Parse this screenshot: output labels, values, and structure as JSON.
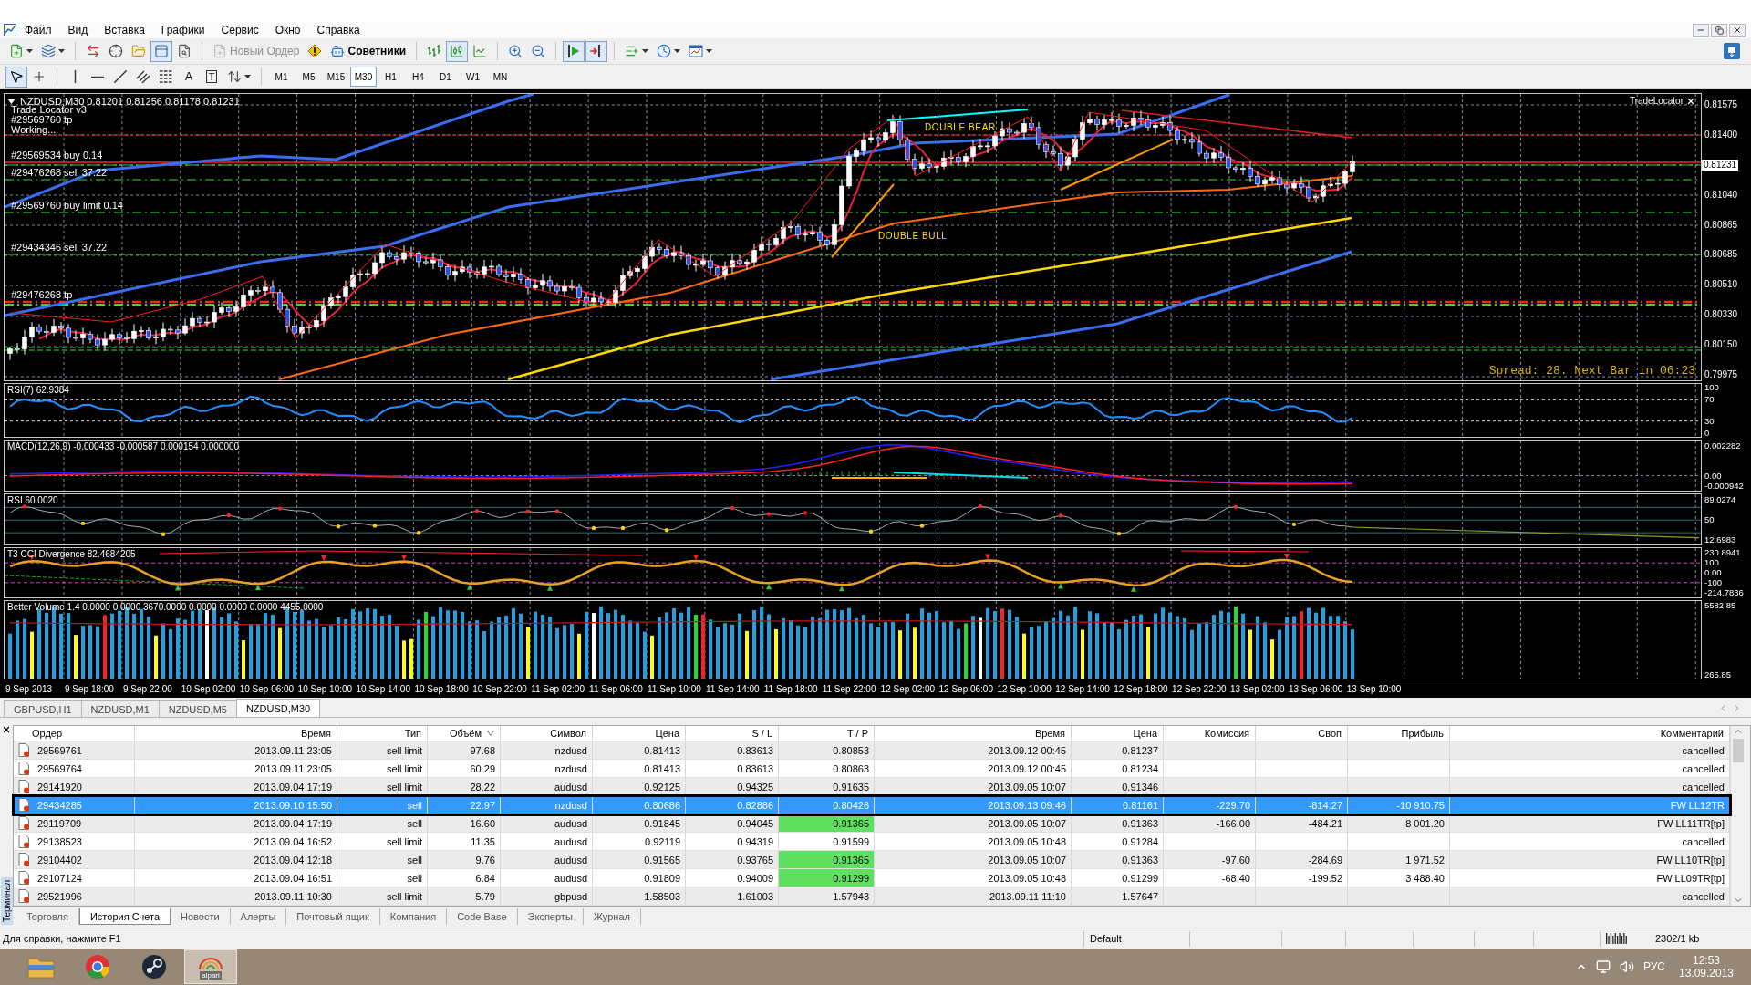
{
  "menu": [
    "Файл",
    "Вид",
    "Вставка",
    "Графики",
    "Сервис",
    "Окно",
    "Справка"
  ],
  "toolbar": [
    [
      {
        "kind": "new_chart",
        "pressed": false,
        "disabled": false
      },
      {
        "kind": "profiles",
        "pressed": false,
        "disabled": false
      }
    ],
    [
      {
        "kind": "market_watch",
        "pressed": false,
        "disabled": false
      },
      {
        "kind": "data_window",
        "pressed": false,
        "disabled": false
      },
      {
        "kind": "navigator",
        "pressed": false,
        "disabled": false
      },
      {
        "kind": "terminal",
        "pressed": true,
        "disabled": false
      },
      {
        "kind": "tester",
        "pressed": false,
        "disabled": false
      }
    ],
    [
      {
        "kind": "new_order",
        "label": "Новый Ордер",
        "pressed": false,
        "disabled": true
      },
      {
        "kind": "metaeditor",
        "pressed": false,
        "disabled": false
      },
      {
        "kind": "experts",
        "label": "Советники",
        "pressed": false,
        "disabled": false
      }
    ],
    [
      {
        "kind": "bar_chart",
        "pressed": false,
        "disabled": false
      },
      {
        "kind": "candle_chart",
        "pressed": true,
        "disabled": false
      },
      {
        "kind": "line_chart",
        "pressed": false,
        "disabled": false
      }
    ],
    [
      {
        "kind": "zoom_in",
        "pressed": false,
        "disabled": false
      },
      {
        "kind": "zoom_out",
        "pressed": false,
        "disabled": false
      }
    ],
    [
      {
        "kind": "auto_scroll",
        "pressed": true,
        "disabled": false
      },
      {
        "kind": "chart_shift",
        "pressed": true,
        "disabled": false
      }
    ],
    [
      {
        "kind": "indicators",
        "pressed": false,
        "disabled": false
      },
      {
        "kind": "periods",
        "pressed": false,
        "disabled": false
      },
      {
        "kind": "templates",
        "pressed": false,
        "disabled": false
      }
    ]
  ],
  "drawing_tools": [
    [
      {
        "kind": "cursor",
        "pressed": true
      },
      {
        "kind": "crosshair",
        "pressed": false
      }
    ],
    [
      {
        "kind": "vertical_line",
        "pressed": false
      },
      {
        "kind": "horizontal_line",
        "pressed": false
      },
      {
        "kind": "trend_line",
        "pressed": false
      },
      {
        "kind": "fibo_channel",
        "pressed": false
      },
      {
        "kind": "fibo_levels",
        "pressed": false
      },
      {
        "kind": "text",
        "label": "A",
        "pressed": false
      },
      {
        "kind": "text_label",
        "label": "T",
        "pressed": false
      },
      {
        "kind": "arrows",
        "pressed": false
      }
    ]
  ],
  "timeframes": [
    {
      "label": "M1",
      "selected": false
    },
    {
      "label": "M5",
      "selected": false
    },
    {
      "label": "M15",
      "selected": false
    },
    {
      "label": "M30",
      "selected": true
    },
    {
      "label": "H1",
      "selected": false
    },
    {
      "label": "H4",
      "selected": false
    },
    {
      "label": "D1",
      "selected": false
    },
    {
      "label": "W1",
      "selected": false
    },
    {
      "label": "MN",
      "selected": false
    }
  ],
  "chart": {
    "header": "NZDUSD,M30 0.81201 0.81256 0.81178 0.81231",
    "trade_labels": [
      "Trade Locator v3",
      "#29569760 tp",
      "Working...",
      "#29569534 buy 0.14",
      "#29476268 sell 37.22",
      "#29569760 buy limit 0.14",
      "#29434346 sell 37.22",
      "#29476268 tp"
    ],
    "patterns": [
      "DOUBLE BEAR",
      "DOUBLE BULL"
    ],
    "panel_title": "TradeLocator",
    "spread_info": "Spread: 28. Next Bar in 06:23",
    "price_ticks": [
      "0.81575",
      "0.81400",
      "0.81040",
      "0.80865",
      "0.80685",
      "0.80510",
      "0.80330",
      "0.80150",
      "0.79975"
    ],
    "current_price": "0.81231",
    "indicators": [
      {
        "kind": "rsi",
        "title": "RSI(7) 62.9384",
        "ticks": [
          "100",
          "70",
          "30",
          "0"
        ]
      },
      {
        "kind": "macd",
        "title": "MACD(12,26,9) -0.000433 -0.000587 0.000154 0.000000",
        "ticks": [
          "0.002282",
          "0.00",
          "-0.000942"
        ]
      },
      {
        "kind": "rsi_signals",
        "title": "RSI 60.0020",
        "ticks": [
          "89.0274",
          "50",
          "12.6983"
        ]
      },
      {
        "kind": "cci",
        "title": "T3 CCI Divergence 82.4684205",
        "ticks": [
          "230.8941",
          "100",
          "0.00",
          "-100",
          "-214.7836"
        ]
      },
      {
        "kind": "volume",
        "title": "Better Volume 1.4 0.0000 0.0000 3670.0000 0.0000 0.0000 0.0000 4455.0000",
        "ticks": [
          "5582.85",
          "265.85"
        ]
      }
    ],
    "time_ticks": [
      "9 Sep 2013",
      "9 Sep 18:00",
      "9 Sep 22:00",
      "10 Sep 02:00",
      "10 Sep 06:00",
      "10 Sep 10:00",
      "10 Sep 14:00",
      "10 Sep 18:00",
      "10 Sep 22:00",
      "11 Sep 02:00",
      "11 Sep 06:00",
      "11 Sep 10:00",
      "11 Sep 14:00",
      "11 Sep 18:00",
      "11 Sep 22:00",
      "12 Sep 02:00",
      "12 Sep 06:00",
      "12 Sep 10:00",
      "12 Sep 14:00",
      "12 Sep 18:00",
      "12 Sep 22:00",
      "13 Sep 02:00",
      "13 Sep 06:00",
      "13 Sep 10:00"
    ]
  },
  "chart_tabs": [
    {
      "label": "GBPUSD,H1",
      "selected": false
    },
    {
      "label": "NZDUSD,M1",
      "selected": false
    },
    {
      "label": "NZDUSD,M5",
      "selected": false
    },
    {
      "label": "NZDUSD,M30",
      "selected": true
    }
  ],
  "terminal": {
    "side_label": "Терминал",
    "columns": [
      {
        "label": "Ордер",
        "sorted": false
      },
      {
        "label": "Время",
        "sorted": false
      },
      {
        "label": "Тип",
        "sorted": false
      },
      {
        "label": "Объём",
        "sorted": true
      },
      {
        "label": "Символ",
        "sorted": false
      },
      {
        "label": "Цена",
        "sorted": false
      },
      {
        "label": "S / L",
        "sorted": false
      },
      {
        "label": "T / P",
        "sorted": false
      },
      {
        "label": "Время",
        "sorted": false
      },
      {
        "label": "Цена",
        "sorted": false
      },
      {
        "label": "Комиссия",
        "sorted": false
      },
      {
        "label": "Своп",
        "sorted": false
      },
      {
        "label": "Прибыль",
        "sorted": false
      },
      {
        "label": "Комментарий",
        "sorted": false
      }
    ],
    "rows": [
      {
        "order": "29569761",
        "open_time": "2013.09.11 23:05",
        "type": "sell limit",
        "volume": "97.68",
        "symbol": "nzdusd",
        "open_price": "0.81413",
        "sl": "0.83613",
        "tp": "0.80853",
        "close_time": "2013.09.12 00:45",
        "close_price": "0.81237",
        "comment": "cancelled",
        "selected": false,
        "tp_hit": false
      },
      {
        "order": "29569764",
        "open_time": "2013.09.11 23:05",
        "type": "sell limit",
        "volume": "60.29",
        "symbol": "nzdusd",
        "open_price": "0.81413",
        "sl": "0.83613",
        "tp": "0.80863",
        "close_time": "2013.09.12 00:45",
        "close_price": "0.81234",
        "comment": "cancelled",
        "selected": false,
        "tp_hit": false
      },
      {
        "order": "29141920",
        "open_time": "2013.09.04 17:19",
        "type": "sell limit",
        "volume": "28.22",
        "symbol": "audusd",
        "open_price": "0.92125",
        "sl": "0.94325",
        "tp": "0.91635",
        "close_time": "2013.09.05 10:07",
        "close_price": "0.91346",
        "comment": "cancelled",
        "selected": false,
        "tp_hit": false
      },
      {
        "order": "29434285",
        "open_time": "2013.09.10 15:50",
        "type": "sell",
        "volume": "22.97",
        "symbol": "nzdusd",
        "open_price": "0.80686",
        "sl": "0.82886",
        "tp": "0.80426",
        "close_time": "2013.09.13 09:46",
        "close_price": "0.81161",
        "commission": "-229.70",
        "swap": "-814.27",
        "profit": "-10 910.75",
        "comment": "FW LL12TR",
        "selected": true,
        "tp_hit": false
      },
      {
        "order": "29119709",
        "open_time": "2013.09.04 17:19",
        "type": "sell",
        "volume": "16.60",
        "symbol": "audusd",
        "open_price": "0.91845",
        "sl": "0.94045",
        "tp": "0.91365",
        "close_time": "2013.09.05 10:07",
        "close_price": "0.91363",
        "commission": "-166.00",
        "swap": "-484.21",
        "profit": "8 001.20",
        "comment": "FW LL11TR[tp]",
        "selected": false,
        "tp_hit": true
      },
      {
        "order": "29138523",
        "open_time": "2013.09.04 16:52",
        "type": "sell limit",
        "volume": "11.35",
        "symbol": "audusd",
        "open_price": "0.92119",
        "sl": "0.94319",
        "tp": "0.91599",
        "close_time": "2013.09.05 10:48",
        "close_price": "0.91284",
        "comment": "cancelled",
        "selected": false,
        "tp_hit": false
      },
      {
        "order": "29104402",
        "open_time": "2013.09.04 12:18",
        "type": "sell",
        "volume": "9.76",
        "symbol": "audusd",
        "open_price": "0.91565",
        "sl": "0.93765",
        "tp": "0.91365",
        "close_time": "2013.09.05 10:07",
        "close_price": "0.91363",
        "commission": "-97.60",
        "swap": "-284.69",
        "profit": "1 971.52",
        "comment": "FW LL10TR[tp]",
        "selected": false,
        "tp_hit": true
      },
      {
        "order": "29107124",
        "open_time": "2013.09.04 16:51",
        "type": "sell",
        "volume": "6.84",
        "symbol": "audusd",
        "open_price": "0.91809",
        "sl": "0.94009",
        "tp": "0.91299",
        "close_time": "2013.09.05 10:48",
        "close_price": "0.91299",
        "commission": "-68.40",
        "swap": "-199.52",
        "profit": "3 488.40",
        "comment": "FW LL09TR[tp]",
        "selected": false,
        "tp_hit": true
      },
      {
        "order": "29521996",
        "open_time": "2013.09.11 10:30",
        "type": "sell limit",
        "volume": "5.79",
        "symbol": "gbpusd",
        "open_price": "1.58503",
        "sl": "1.61003",
        "tp": "1.57943",
        "close_time": "2013.09.11 11:10",
        "close_price": "1.57647",
        "comment": "cancelled",
        "selected": false,
        "tp_hit": false
      }
    ],
    "tabs": [
      {
        "label": "Торговля",
        "selected": false
      },
      {
        "label": "История Счета",
        "selected": true
      },
      {
        "label": "Новости",
        "selected": false
      },
      {
        "label": "Алерты",
        "selected": false
      },
      {
        "label": "Почтовый ящик",
        "selected": false
      },
      {
        "label": "Компания",
        "selected": false
      },
      {
        "label": "Code Base",
        "selected": false
      },
      {
        "label": "Эксперты",
        "selected": false
      },
      {
        "label": "Журнал",
        "selected": false
      }
    ]
  },
  "status_bar": {
    "help": "Для справки, нажмите F1",
    "profile": "Default",
    "traffic": "2302/1 kb"
  },
  "taskbar": {
    "apps": [
      {
        "kind": "folder",
        "active": false
      },
      {
        "kind": "browser",
        "active": false
      },
      {
        "kind": "game_client",
        "active": false
      },
      {
        "kind": "broker",
        "label": "alpari",
        "active": true
      }
    ],
    "tray": {
      "language": "РУС",
      "time": "12:53",
      "date": "13.09.2013"
    }
  }
}
